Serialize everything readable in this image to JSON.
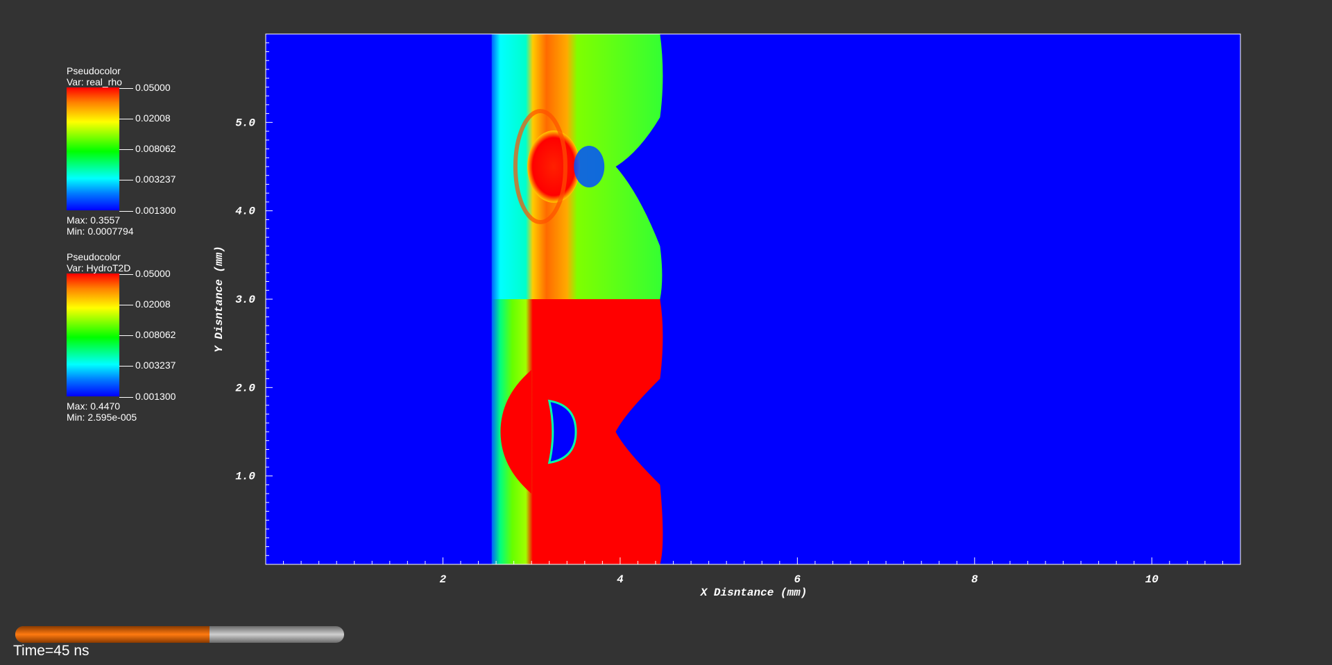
{
  "legends": [
    {
      "plot_type": "Pseudocolor",
      "var_label": "Var: real_rho",
      "ticks": [
        "0.05000",
        "0.02008",
        "0.008062",
        "0.003237",
        "0.001300"
      ],
      "max_label": "Max:  0.3557",
      "min_label": "Min:  0.0007794"
    },
    {
      "plot_type": "Pseudocolor",
      "var_label": "Var: HydroT2D",
      "ticks": [
        "0.05000",
        "0.02008",
        "0.008062",
        "0.003237",
        "0.001300"
      ],
      "max_label": "Max:  0.4470",
      "min_label": "Min:  2.595e-005"
    }
  ],
  "time": {
    "label": "Time=45 ns",
    "progress": 0.59
  },
  "chart_data": {
    "type": "heatmap",
    "xlabel": "X Disntance (mm)",
    "ylabel": "Y Disntance (mm)",
    "xlim": [
      0,
      11
    ],
    "ylim": [
      0,
      6
    ],
    "x_ticks": [
      2,
      4,
      6,
      8,
      10
    ],
    "x_tick_labels": [
      "2",
      "4",
      "6",
      "8",
      "10"
    ],
    "y_ticks": [
      1.0,
      2.0,
      3.0,
      4.0,
      5.0
    ],
    "y_tick_labels": [
      "1.0",
      "2.0",
      "3.0",
      "4.0",
      "5.0"
    ],
    "colors": {
      "background": "#0000ff",
      "high": "#ff0000",
      "mid": "#00ff00",
      "low": "#00ffff"
    },
    "upper_panel_var": "real_rho",
    "lower_panel_var": "HydroT2D",
    "panel_split_y": 3.0
  }
}
